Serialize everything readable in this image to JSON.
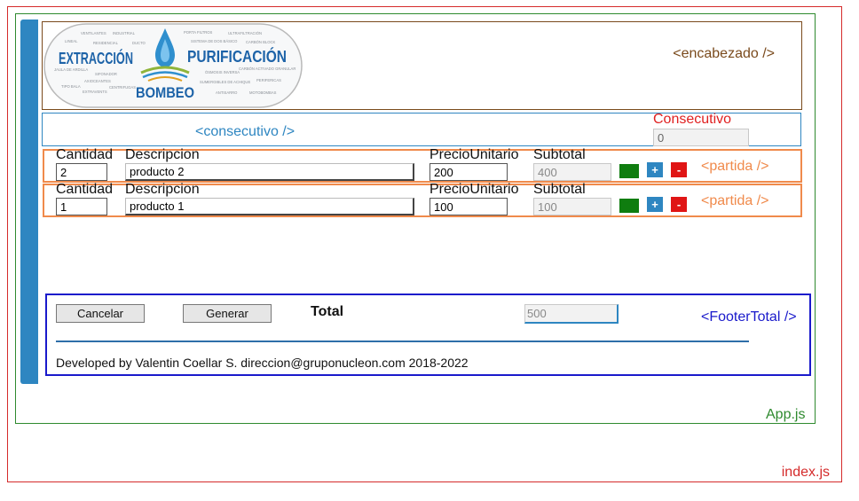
{
  "index": {
    "label": "index.js"
  },
  "app": {
    "label": "App.js"
  },
  "header": {
    "tag": "<encabezado />",
    "logo": {
      "word_extraccion": "EXTRACCIÓN",
      "word_purificacion": "PURIFICACIÓN",
      "word_bombeo": "BOMBEO",
      "cloud_words": [
        "VENTILANTES",
        "INDUSTRIAL",
        "LINEAL",
        "RESIDENCIAL",
        "DUCTO",
        "JAULA DE ARDILLA",
        "SIFONADOR",
        "AXIOCEANTES",
        "CENTRIFUGAS",
        "TIPO BALA",
        "EXTRAVENTS",
        "PORTA FILTROS",
        "ULTRAFILTRACIÓN",
        "SISTEMA DE DOS BÁSICO",
        "CARBÓN BLOCK",
        "ÓSMOSIS INVERSA",
        "CARBÓN ACTIVADO GRANULAR",
        "SUMERGIBLES DE ACHIQUE",
        "PERIFERICAS",
        "ANTISARRO",
        "MOTOBOMBAS"
      ]
    }
  },
  "consecutivo": {
    "tag": "<consecutivo />",
    "title": "Consecutivo",
    "value": "0"
  },
  "partidas": [
    {
      "hdr_qty": "Cantidad",
      "hdr_desc": "Descripcion",
      "hdr_price": "PrecioUnitario",
      "hdr_sub": "Subtotal",
      "qty": "2",
      "desc": "producto 2",
      "price": "200",
      "subtotal": "400",
      "plus": "+",
      "minus": "-",
      "tag": "<partida />"
    },
    {
      "hdr_qty": "Cantidad",
      "hdr_desc": "Descripcion",
      "hdr_price": "PrecioUnitario",
      "hdr_sub": "Subtotal",
      "qty": "1",
      "desc": "producto 1",
      "price": "100",
      "subtotal": "100",
      "plus": "+",
      "minus": "-",
      "tag": "<partida />"
    }
  ],
  "footer": {
    "cancel_label": "Cancelar",
    "generate_label": "Generar",
    "total_label": "Total",
    "total_value": "500",
    "tag": "<FooterTotal />",
    "credits": "Developed by Valentin Coellar S. direccion@gruponucleon.com 2018-2022"
  },
  "colors": {
    "index_border": "#d52b2b",
    "app_border": "#2f8a2f",
    "accent_blue": "#2e86c1",
    "header_border": "#7a4a1c",
    "partida_border": "#f08a4b",
    "footer_border": "#1a1acb",
    "swatch_green": "#0f7d0f",
    "minus_red": "#e01515"
  }
}
